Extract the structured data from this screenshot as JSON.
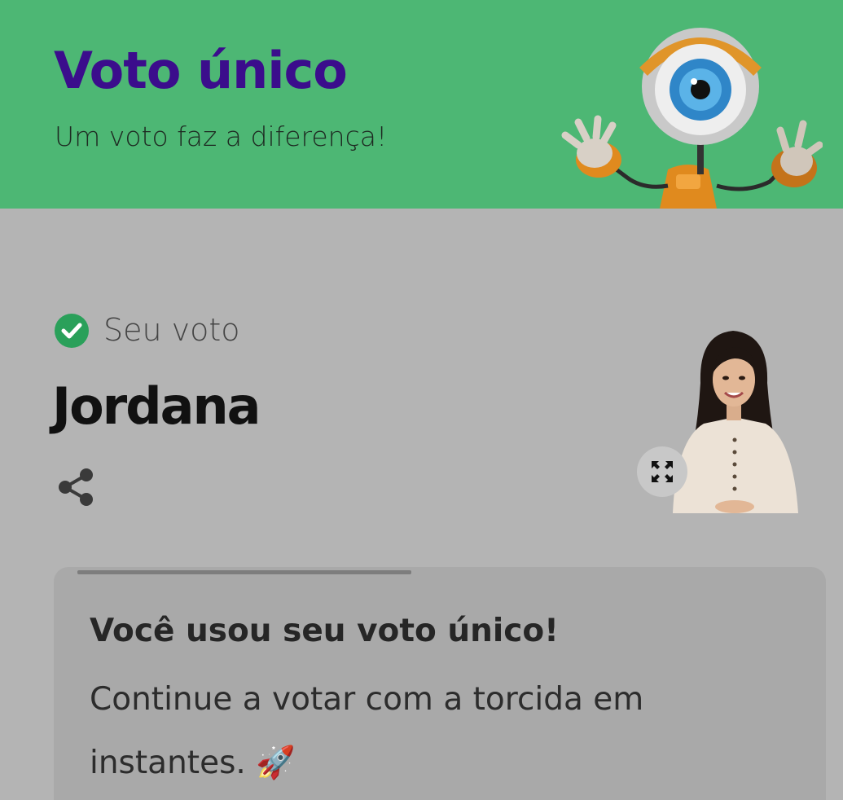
{
  "header": {
    "title": "Voto único",
    "subtitle": "Um voto faz a diferença!",
    "mascot_icon": "big-brother-eye-robot",
    "background_color": "#4db774",
    "title_color": "#3b0d8c"
  },
  "vote": {
    "status_icon": "check-circle-icon",
    "label": "Seu voto",
    "candidate_name": "Jordana",
    "share_icon": "share-icon",
    "expand_icon": "expand-icon"
  },
  "card": {
    "title": "Você usou seu voto único!",
    "message": "Continue a votar com a torcida em instantes. 🚀"
  }
}
